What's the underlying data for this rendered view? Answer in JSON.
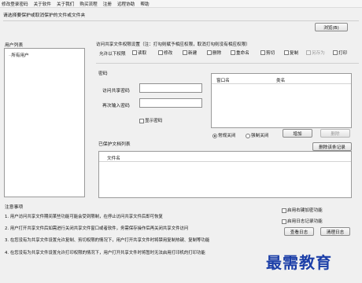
{
  "menu": [
    "修改登录密码",
    "关于软件",
    "关于我们",
    "购买流程",
    "注册",
    "远程协助",
    "帮助"
  ],
  "instruction": "请选择要保护或取消保护的文件或文件夹",
  "browse_button": "浏览(B)",
  "user_list": {
    "title": "用户列表",
    "items": [
      "所有用户"
    ]
  },
  "permissions": {
    "title": "访问共享文件权限设置（注：打勾则赋予相应权限，取消打勾则没有相应权限）",
    "allow_label": "允许以下权限",
    "items": [
      {
        "label": "读取",
        "enabled": true
      },
      {
        "label": "修改",
        "enabled": true
      },
      {
        "label": "新建",
        "enabled": true
      },
      {
        "label": "删除",
        "enabled": true
      },
      {
        "label": "重命名",
        "enabled": true
      },
      {
        "label": "剪切",
        "enabled": true
      },
      {
        "label": "复制",
        "enabled": true
      },
      {
        "label": "另存为",
        "enabled": false
      },
      {
        "label": "打印",
        "enabled": true
      }
    ]
  },
  "password": {
    "title": "密码",
    "access_label": "访问共享密码",
    "confirm_label": "再次输入密码",
    "show_label": "显示密码"
  },
  "window_table": {
    "col1": "窗口名",
    "col2": "类名"
  },
  "close_mode": {
    "normal": "常规关闭",
    "force": "强制关闭",
    "add": "增加",
    "delete": "删除"
  },
  "protected_docs": {
    "title": "已保护文档列表",
    "column": "文件名",
    "delete_record": "删除该条记录"
  },
  "notes": {
    "title": "注意事项",
    "items": [
      "1. 用户访问共享文件期间某些功能可能会受到限制，在停止访问共享文件后即可恢复",
      "2. 用户打开共享文件后如需进行关闭共享文件窗口或者软件，务需保存操作后再关闭共享文件访问",
      "3. 在您没有为共享文件设置允许复制、剪切权限的情况下，用户打开共享文件时将禁用复制热键、复制等功能",
      "4. 在您没有为共享文件设置允许打印权限的情况下，用户打开共享文件时将暂时无法启用打印机的打印功能"
    ]
  },
  "options": {
    "right_click": "启用右键加密功能",
    "log": "启用日志记录功能",
    "view_log": "查看日志",
    "clear_log": "清理日志"
  },
  "watermark": "最需教育"
}
